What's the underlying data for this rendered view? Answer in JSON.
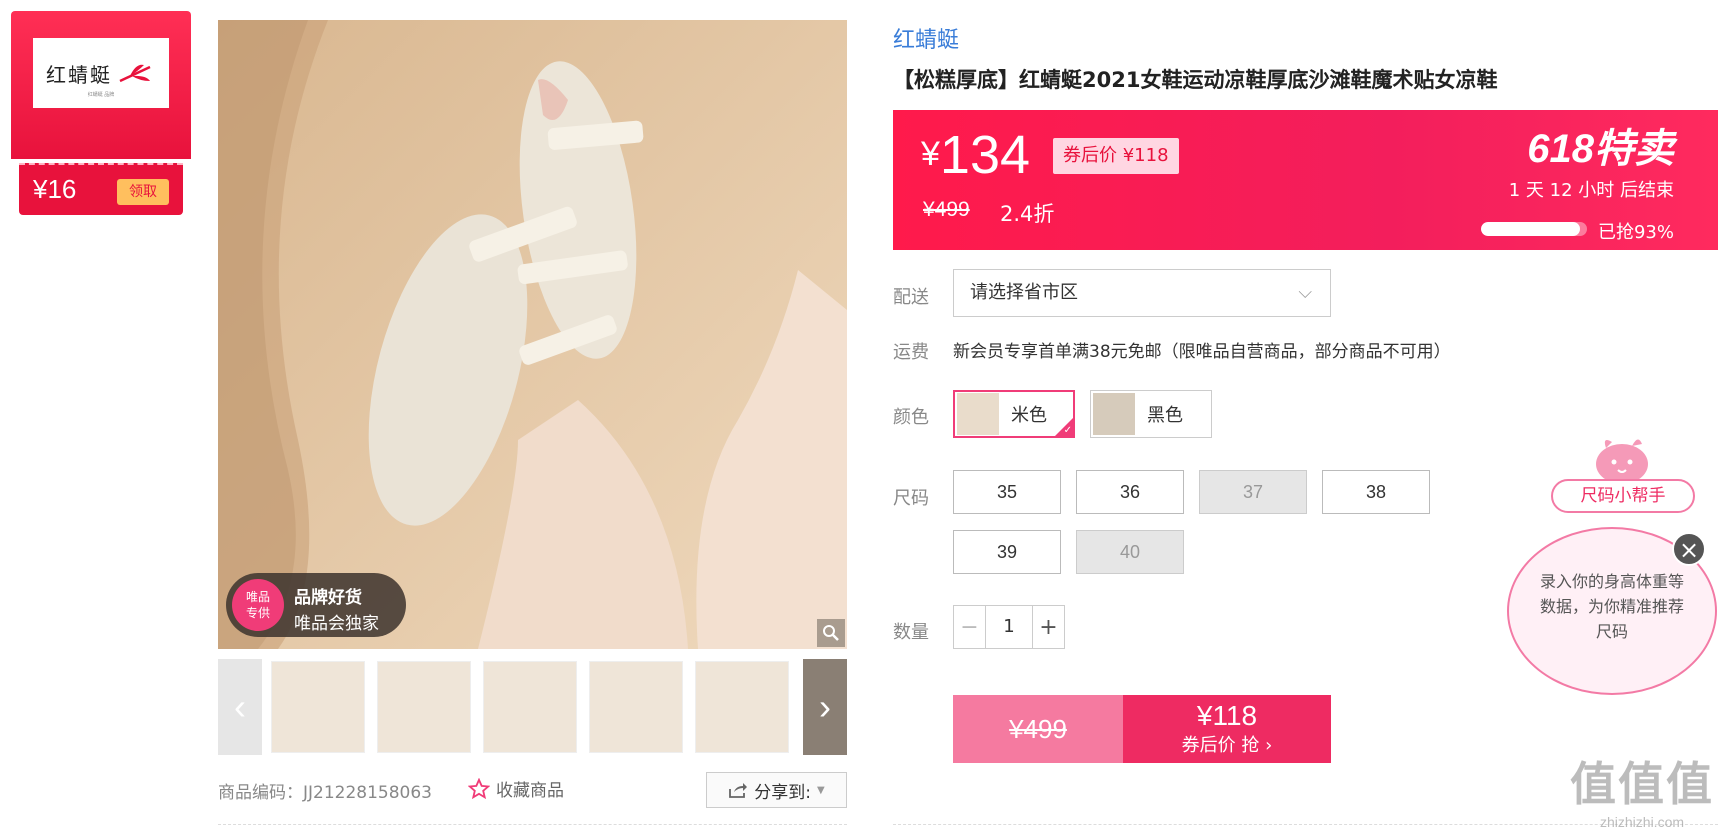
{
  "coupon": {
    "brand_logo_text": "红蜻蜓",
    "brand_logo_sub": "红蜻蜓 品牌",
    "amount": "¥16",
    "claim_label": "领取",
    "colors": {
      "primary": "#e8123c",
      "claim_bg": "#ffbf5e"
    }
  },
  "gallery": {
    "badge_circle": "唯品\n专供",
    "badge_title": "品牌好货",
    "badge_subtitle": "唯品会独家",
    "thumbnail_count": 5
  },
  "meta": {
    "product_code": "商品编码：JJ21228158063",
    "favorite_label": "收藏商品",
    "share_label": "分享到:"
  },
  "product": {
    "brand": "红蜻蜓",
    "title": "【松糕厚底】红蜻蜓2021女鞋运动凉鞋厚底沙滩鞋魔术贴女凉鞋"
  },
  "price": {
    "currency": "¥",
    "current": "134",
    "coupon_price": "券后价 ¥118",
    "original": "¥499",
    "discount": "2.4折",
    "sale_title": "618特卖",
    "countdown": "1 天 12 小时 后结束",
    "sold_percent": 93,
    "sold_label": "已抢93%",
    "colors": {
      "banner": "#ff1a4b",
      "coupon_bg": "#ffd6e2"
    }
  },
  "delivery": {
    "label": "配送",
    "placeholder": "请选择省市区"
  },
  "shipping": {
    "label": "运费",
    "text": "新会员专享首单满38元免邮（限唯品自营商品，部分商品不可用）"
  },
  "color": {
    "label": "颜色",
    "options": [
      {
        "name": "米色",
        "selected": true
      },
      {
        "name": "黑色",
        "selected": false
      }
    ]
  },
  "size": {
    "label": "尺码",
    "options": [
      {
        "value": "35",
        "available": true
      },
      {
        "value": "36",
        "available": true
      },
      {
        "value": "37",
        "available": false
      },
      {
        "value": "38",
        "available": true
      },
      {
        "value": "39",
        "available": true
      },
      {
        "value": "40",
        "available": false
      }
    ]
  },
  "quantity": {
    "label": "数量",
    "value": "1",
    "minus": "−",
    "plus": "+"
  },
  "buy": {
    "original_price": "¥499",
    "coupon_price": "¥118",
    "action": "券后价 抢 ›",
    "colors": {
      "left": "#f57aa0",
      "right": "#ee2b62"
    }
  },
  "size_helper": {
    "title": "尺码小帮手",
    "message": "录入你的身高体重等数据，为你精准推荐尺码",
    "close": "×"
  },
  "watermark": {
    "logo": "值值值",
    "url": "zhizhizhi.com"
  }
}
